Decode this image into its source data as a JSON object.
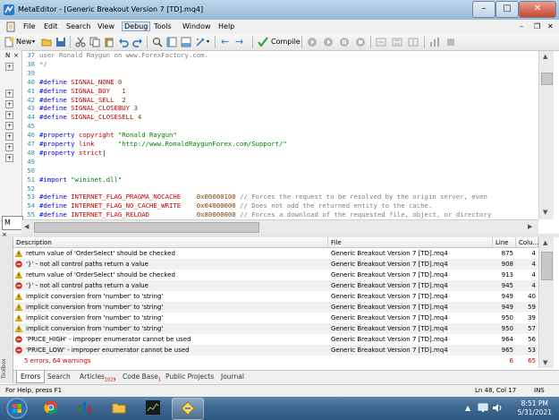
{
  "window": {
    "title": "MetaEditor - [Generic Breakout Version 7 [TD].mq4]"
  },
  "menu": [
    "File",
    "Edit",
    "Search",
    "View",
    "Debug",
    "Tools",
    "Window",
    "Help"
  ],
  "toolbar": {
    "new_label": "New",
    "compile_label": "Compile"
  },
  "code_lines": [
    {
      "num": "37",
      "parts": [
        {
          "t": "user Ronald Raygun on www.ForexFactory.com.",
          "c": "c"
        }
      ]
    },
    {
      "num": "38",
      "parts": [
        {
          "t": "*/",
          "c": "c"
        }
      ]
    },
    {
      "num": "39",
      "parts": []
    },
    {
      "num": "40",
      "parts": [
        {
          "t": "#define ",
          "c": "k"
        },
        {
          "t": "SIGNAL_NONE ",
          "c": "n"
        },
        {
          "t": "0",
          "c": "num"
        }
      ]
    },
    {
      "num": "41",
      "parts": [
        {
          "t": "#define ",
          "c": "k"
        },
        {
          "t": "SIGNAL_BUY   ",
          "c": "n"
        },
        {
          "t": "1",
          "c": "num"
        }
      ]
    },
    {
      "num": "42",
      "parts": [
        {
          "t": "#define ",
          "c": "k"
        },
        {
          "t": "SIGNAL_SELL  ",
          "c": "n"
        },
        {
          "t": "2",
          "c": "num"
        }
      ]
    },
    {
      "num": "43",
      "parts": [
        {
          "t": "#define ",
          "c": "k"
        },
        {
          "t": "SIGNAL_CLOSEBUY ",
          "c": "n"
        },
        {
          "t": "3",
          "c": "num"
        }
      ]
    },
    {
      "num": "44",
      "parts": [
        {
          "t": "#define ",
          "c": "k"
        },
        {
          "t": "SIGNAL_CLOSESELL ",
          "c": "n"
        },
        {
          "t": "4",
          "c": "num"
        }
      ]
    },
    {
      "num": "45",
      "parts": []
    },
    {
      "num": "46",
      "parts": [
        {
          "t": "#property ",
          "c": "k"
        },
        {
          "t": "copyright ",
          "c": "n"
        },
        {
          "t": "\"Ronald Raygun\"",
          "c": "s"
        }
      ]
    },
    {
      "num": "47",
      "parts": [
        {
          "t": "#property ",
          "c": "k"
        },
        {
          "t": "link      ",
          "c": "n"
        },
        {
          "t": "\"http://www.RonaldRaygunForex.com/Support/\"",
          "c": "s"
        }
      ]
    },
    {
      "num": "48",
      "parts": [
        {
          "t": "#property ",
          "c": "k"
        },
        {
          "t": "strict",
          "c": "n"
        },
        {
          "t": "|",
          "c": ""
        }
      ]
    },
    {
      "num": "49",
      "parts": []
    },
    {
      "num": "50",
      "parts": []
    },
    {
      "num": "51",
      "parts": [
        {
          "t": "#import ",
          "c": "k"
        },
        {
          "t": "\"wininet.dll\"",
          "c": "s"
        }
      ]
    },
    {
      "num": "52",
      "parts": []
    },
    {
      "num": "53",
      "parts": [
        {
          "t": "#define ",
          "c": "k"
        },
        {
          "t": "INTERNET_FLAG_PRAGMA_NOCACHE    ",
          "c": "n"
        },
        {
          "t": "0x00000100",
          "c": "num"
        },
        {
          "t": " // Forces the request to be resolved by the origin server, even",
          "c": "c"
        }
      ]
    },
    {
      "num": "54",
      "parts": [
        {
          "t": "#define ",
          "c": "k"
        },
        {
          "t": "INTERNET_FLAG_NO_CACHE_WRITE    ",
          "c": "n"
        },
        {
          "t": "0x04000000",
          "c": "num"
        },
        {
          "t": " // Does not add the returned entity to the cache.",
          "c": "c"
        }
      ]
    },
    {
      "num": "55",
      "parts": [
        {
          "t": "#define ",
          "c": "k"
        },
        {
          "t": "INTERNET_FLAG_RELOAD            ",
          "c": "n"
        },
        {
          "t": "0x80000000",
          "c": "num"
        },
        {
          "t": " // Forces a download of the requested file, object, or directory",
          "c": "c"
        }
      ]
    }
  ],
  "errors": {
    "columns": {
      "description": "Description",
      "file": "File",
      "line": "Line",
      "column": "Colu..."
    },
    "rows": [
      {
        "type": "warning",
        "description": "return value of 'OrderSelect' should be checked",
        "file": "Generic Breakout Version 7 [TD].mq4",
        "line": "875",
        "column": "4"
      },
      {
        "type": "error",
        "description": "'}' - not all control paths return a value",
        "file": "Generic Breakout Version 7 [TD].mq4",
        "line": "908",
        "column": "4"
      },
      {
        "type": "warning",
        "description": "return value of 'OrderSelect' should be checked",
        "file": "Generic Breakout Version 7 [TD].mq4",
        "line": "913",
        "column": "4"
      },
      {
        "type": "error",
        "description": "'}' - not all control paths return a value",
        "file": "Generic Breakout Version 7 [TD].mq4",
        "line": "945",
        "column": "4"
      },
      {
        "type": "warning",
        "description": "implicit conversion from 'number' to 'string'",
        "file": "Generic Breakout Version 7 [TD].mq4",
        "line": "949",
        "column": "40"
      },
      {
        "type": "warning",
        "description": "implicit conversion from 'number' to 'string'",
        "file": "Generic Breakout Version 7 [TD].mq4",
        "line": "949",
        "column": "59"
      },
      {
        "type": "warning",
        "description": "implicit conversion from 'number' to 'string'",
        "file": "Generic Breakout Version 7 [TD].mq4",
        "line": "950",
        "column": "39"
      },
      {
        "type": "warning",
        "description": "implicit conversion from 'number' to 'string'",
        "file": "Generic Breakout Version 7 [TD].mq4",
        "line": "950",
        "column": "57"
      },
      {
        "type": "error",
        "description": "'PRICE_HIGH' - improper enumerator cannot be used",
        "file": "Generic Breakout Version 7 [TD].mq4",
        "line": "964",
        "column": "56"
      },
      {
        "type": "error",
        "description": "'PRICE_LOW' - improper enumerator cannot be used",
        "file": "Generic Breakout Version 7 [TD].mq4",
        "line": "965",
        "column": "53"
      },
      {
        "type": "summary",
        "description": "5 errors, 64 warnings",
        "file": "",
        "line": "6",
        "column": "65"
      }
    ]
  },
  "bottom_tabs": [
    {
      "label": "Errors",
      "badge": "",
      "active": true
    },
    {
      "label": "Search",
      "badge": "",
      "active": false
    },
    {
      "label": "Articles",
      "badge": "1029",
      "active": false
    },
    {
      "label": "Code Base",
      "badge": "1",
      "active": false
    },
    {
      "label": "Public Projects",
      "badge": "",
      "active": false
    },
    {
      "label": "Journal",
      "badge": "",
      "active": false
    }
  ],
  "toolbox_label": "Toolbox",
  "status": {
    "help": "For Help, press F1",
    "position": "Ln 48, Col 17",
    "mode": "INS"
  },
  "clock": {
    "time": "8:51 PM",
    "date": "5/31/2021"
  }
}
